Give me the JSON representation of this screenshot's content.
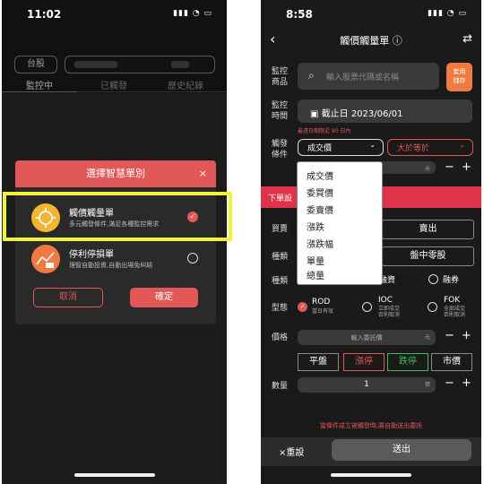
{
  "left": {
    "time": "11:02",
    "market": "台股",
    "tabs": [
      "監控中",
      "已觸發",
      "歷史紀錄"
    ],
    "modal": {
      "title": "選擇智慧單別",
      "close": "×",
      "options": [
        {
          "title": "觸價觸量單",
          "desc": "多元觸發條件,滿足各種監控需求",
          "selected": true
        },
        {
          "title": "停利停損單",
          "desc": "理智自動投資,自動出場免糾結",
          "selected": false
        }
      ],
      "cancel": "取消",
      "confirm": "確定"
    }
  },
  "right": {
    "time": "8:58",
    "title": "觸價觸量單",
    "info": "ⓘ",
    "back": "‹",
    "swap": "⇄",
    "labels": {
      "monitor_item_1": "監控",
      "monitor_item_2": "商品",
      "monitor_time_1": "監控",
      "monitor_time_2": "時間",
      "trigger_1": "觸發",
      "trigger_2": "條件",
      "buy_sell": "買賣",
      "type1": "種類",
      "type2": "種類",
      "order_type": "型態",
      "price": "價格",
      "quantity": "數量"
    },
    "search_placeholder": "輸入股票代碼或名稱",
    "save_btn_1": "套用",
    "save_btn_2": "儲存",
    "date_value": "截止日 2023/06/01",
    "date_note": "最遠日期限近 90 日內",
    "trigger_field": "成交價",
    "trigger_op": "大於等於",
    "unit_yuan": "元",
    "order_section": "下單設",
    "dropdown": [
      "成交價",
      "委買價",
      "委賣價",
      "漲跌",
      "漲跌幅",
      "單量",
      "總量"
    ],
    "sell": "賣出",
    "odd_lot": "盤中零股",
    "margin_loan": "融資",
    "short_sell": "融券",
    "rod": "ROD",
    "rod_sub": "當日有效",
    "ioc": "IOC",
    "ioc_sub_1": "立即成交",
    "ioc_sub_2": "否則取消",
    "fok": "FOK",
    "fok_sub_1": "全部成交",
    "fok_sub_2": "否則取消",
    "price_placeholder": "輸入委託價",
    "quick": [
      "平盤",
      "漲停",
      "跌停",
      "市價"
    ],
    "quantity_value": "1",
    "unit_lot": "張",
    "footer_note": "當條件成立被觸發時,將自動送出委託",
    "reset": "×重設",
    "send": "送出"
  }
}
